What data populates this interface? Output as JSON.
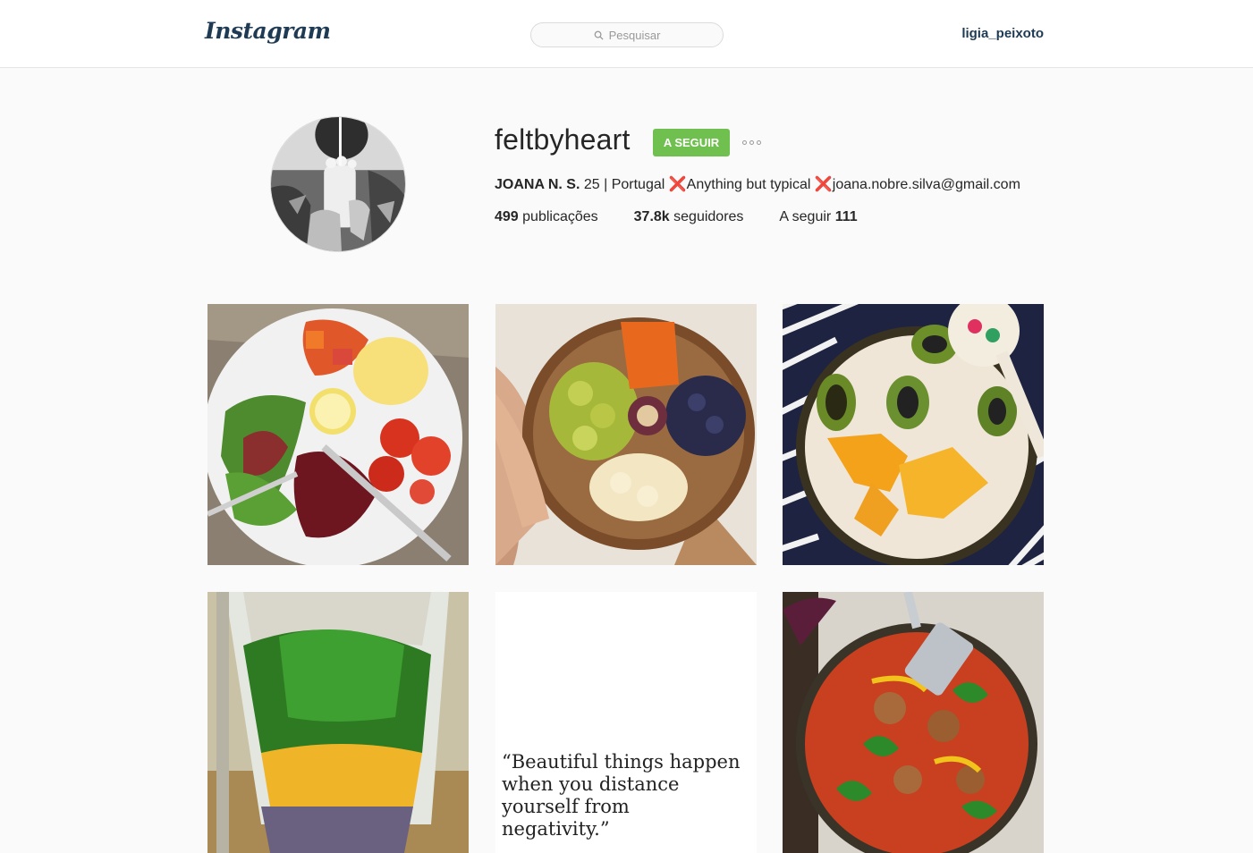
{
  "header": {
    "logo": "Instagram",
    "search_placeholder": "Pesquisar",
    "current_user": "ligia_peixoto"
  },
  "profile": {
    "username": "feltbyheart",
    "follow_button": "A SEGUIR",
    "bio_name": "JOANA N. S.",
    "bio_text": " 25 | Portugal ❌Anything but typical ❌joana.nobre.silva@gmail.com",
    "stats": {
      "posts_count": "499",
      "posts_label": " publicações",
      "followers_count": "37.8k",
      "followers_label": " seguidores",
      "following_label": "A seguir ",
      "following_count": "111"
    }
  },
  "posts": {
    "quote_text": "“Beautiful things happen\nwhen you distance\nyourself from\nnegativity.”"
  },
  "colors": {
    "follow_green": "#70c050",
    "link_navy": "#1f3a53"
  }
}
